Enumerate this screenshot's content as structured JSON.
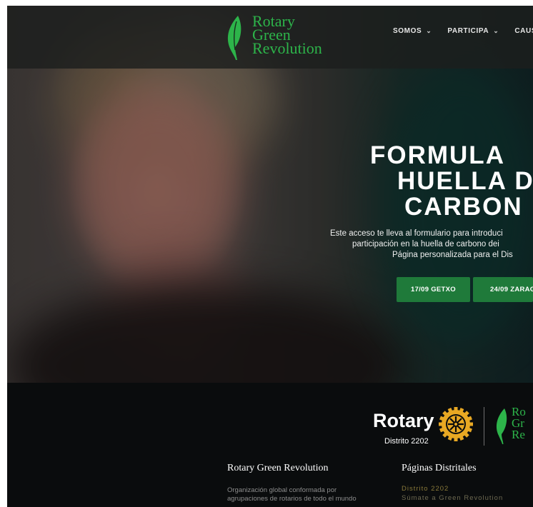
{
  "header": {
    "logo_lines": [
      "Rotary",
      "Green",
      "Revolution"
    ],
    "nav": [
      {
        "label": "SOMOS",
        "has_dropdown": true
      },
      {
        "label": "PARTICIPA",
        "has_dropdown": true
      },
      {
        "label": "CAUSA",
        "has_dropdown": false
      }
    ]
  },
  "hero": {
    "title_lines": [
      "FORMULA",
      "HUELLA D",
      "CARBON"
    ],
    "description_lines": [
      "Este acceso te lleva al formulario para introduci",
      "participación en la huella de carbono dei",
      "Página personalizada para el Dis"
    ],
    "buttons": [
      "17/09 GETXO",
      "24/09 ZARAG"
    ]
  },
  "footer": {
    "rotary_word": "Rotary",
    "distrito": "Distrito 2202",
    "rgr_lines": [
      "Ro",
      "Gr",
      "Re"
    ],
    "col1": {
      "title": "Rotary Green Revolution",
      "lines": [
        "Organización global conformada por",
        "agrupaciones de rotarios de todo el mundo"
      ]
    },
    "col2": {
      "title": "Páginas Distritales",
      "links": [
        "Distrito 2202",
        "Súmate a Green Revolution"
      ]
    }
  },
  "colors": {
    "brand_green": "#2db44a",
    "button_green": "#1f7a3a",
    "rotary_gold": "#e8a823"
  }
}
